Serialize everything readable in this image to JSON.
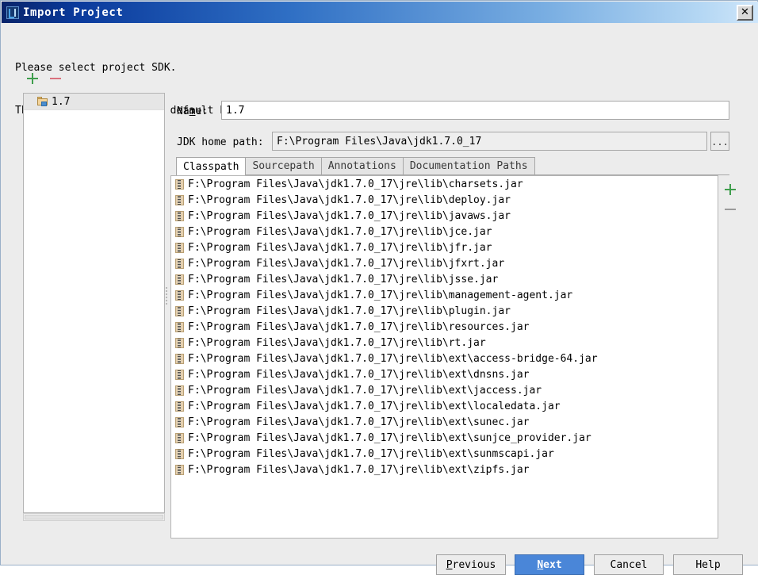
{
  "window": {
    "title": "Import Project",
    "icon": "intellij-idea-icon",
    "close_label": "✕"
  },
  "instructions": {
    "line1": "Please select project SDK.",
    "line2": "This SDK will be used by default by all project modules."
  },
  "sdk_panel": {
    "add_label": "+",
    "remove_label": "−",
    "items": [
      {
        "label": "1.7",
        "icon": "jdk-folder-icon",
        "selected": true
      }
    ]
  },
  "form": {
    "name_label_pre": "Na",
    "name_label_mn": "m",
    "name_label_post": "e:",
    "name_value": "1.7",
    "jdk_home_label": "JDK home path:",
    "jdk_home_value": "F:\\Program Files\\Java\\jdk1.7.0_17",
    "browse_label": "..."
  },
  "tabs": [
    {
      "label": "Classpath",
      "active": true
    },
    {
      "label": "Sourcepath",
      "active": false
    },
    {
      "label": "Annotations",
      "active": false
    },
    {
      "label": "Documentation Paths",
      "active": false
    }
  ],
  "classpath": {
    "add_label": "+",
    "remove_label": "−",
    "entries": [
      "F:\\Program Files\\Java\\jdk1.7.0_17\\jre\\lib\\charsets.jar",
      "F:\\Program Files\\Java\\jdk1.7.0_17\\jre\\lib\\deploy.jar",
      "F:\\Program Files\\Java\\jdk1.7.0_17\\jre\\lib\\javaws.jar",
      "F:\\Program Files\\Java\\jdk1.7.0_17\\jre\\lib\\jce.jar",
      "F:\\Program Files\\Java\\jdk1.7.0_17\\jre\\lib\\jfr.jar",
      "F:\\Program Files\\Java\\jdk1.7.0_17\\jre\\lib\\jfxrt.jar",
      "F:\\Program Files\\Java\\jdk1.7.0_17\\jre\\lib\\jsse.jar",
      "F:\\Program Files\\Java\\jdk1.7.0_17\\jre\\lib\\management-agent.jar",
      "F:\\Program Files\\Java\\jdk1.7.0_17\\jre\\lib\\plugin.jar",
      "F:\\Program Files\\Java\\jdk1.7.0_17\\jre\\lib\\resources.jar",
      "F:\\Program Files\\Java\\jdk1.7.0_17\\jre\\lib\\rt.jar",
      "F:\\Program Files\\Java\\jdk1.7.0_17\\jre\\lib\\ext\\access-bridge-64.jar",
      "F:\\Program Files\\Java\\jdk1.7.0_17\\jre\\lib\\ext\\dnsns.jar",
      "F:\\Program Files\\Java\\jdk1.7.0_17\\jre\\lib\\ext\\jaccess.jar",
      "F:\\Program Files\\Java\\jdk1.7.0_17\\jre\\lib\\ext\\localedata.jar",
      "F:\\Program Files\\Java\\jdk1.7.0_17\\jre\\lib\\ext\\sunec.jar",
      "F:\\Program Files\\Java\\jdk1.7.0_17\\jre\\lib\\ext\\sunjce_provider.jar",
      "F:\\Program Files\\Java\\jdk1.7.0_17\\jre\\lib\\ext\\sunmscapi.jar",
      "F:\\Program Files\\Java\\jdk1.7.0_17\\jre\\lib\\ext\\zipfs.jar"
    ]
  },
  "buttons": {
    "previous": {
      "pre": "",
      "mn": "P",
      "post": "revious"
    },
    "next": {
      "pre": "",
      "mn": "N",
      "post": "ext"
    },
    "cancel": {
      "label": "Cancel"
    },
    "help": {
      "label": "Help"
    }
  },
  "colors": {
    "titlebar_dark": "#0a246a",
    "titlebar_light": "#cfe6fa",
    "accent_button": "#4a86d8",
    "add_green": "#3f9e4d",
    "remove_red": "#d9717e",
    "dialog_bg": "#ececec"
  }
}
